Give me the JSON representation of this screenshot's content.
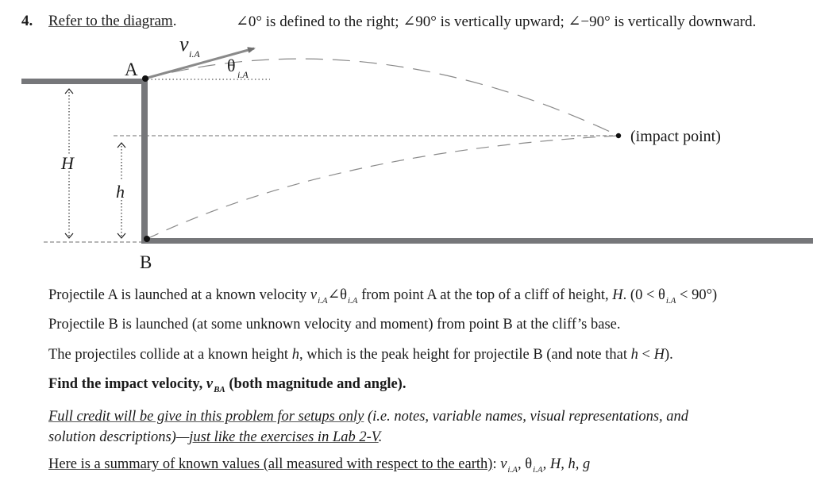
{
  "problem": {
    "number": "4.",
    "refer": "Refer to the diagram",
    "refer_end": ".",
    "angle_def": "∠0° is defined to the right; ∠90° is vertically upward; ∠−90° is vertically downward."
  },
  "diagram": {
    "label_A": "A",
    "label_B": "B",
    "label_H": "H",
    "label_h": "h",
    "velocity_symbol": "v",
    "velocity_sub": "i.A",
    "theta_symbol": "θ",
    "theta_sub": "i.A",
    "impact_label": "(impact point)"
  },
  "paragraphs": {
    "p1": {
      "a": "Projectile A is launched at a known velocity ",
      "v": "v",
      "v_sub": "i.A",
      "angle": "∠θ",
      "theta_sub": "i.A",
      "b": " from point A at the top of a cliff of height, ",
      "H": "H",
      "c": ".  (0 < θ",
      "c_sub": "i.A",
      "d": " < 90°)"
    },
    "p2": "Projectile B is launched (at some unknown velocity and moment) from point B at the cliff’s base.",
    "p3": {
      "a": "The projectiles collide at a known height ",
      "h": "h",
      "b": ", which is the peak height for projectile B (and note that ",
      "h2": "h",
      "lt": " < ",
      "H": "H",
      "c": ")."
    },
    "p4": {
      "a": "Find the impact velocity, ",
      "v": "v",
      "sub": "BA",
      "b": " (both magnitude and angle)."
    },
    "p5": {
      "ul1": "Full credit will be give in this problem for setups only",
      "a": " (i.e. notes, variable names, visual representations, and",
      "line2a": "solution descriptions)—",
      "ul2": "just like the exercises in Lab 2-V",
      "end": "."
    },
    "p6": {
      "ul": "Here is a summary of known values (all measured with respect to the earth)",
      "colon": ":  ",
      "v": "v",
      "v_sub": "i.A",
      "comma1": ", ",
      "theta": "θ",
      "theta_sub": "i.A",
      "rest": ", H, h, g"
    }
  }
}
